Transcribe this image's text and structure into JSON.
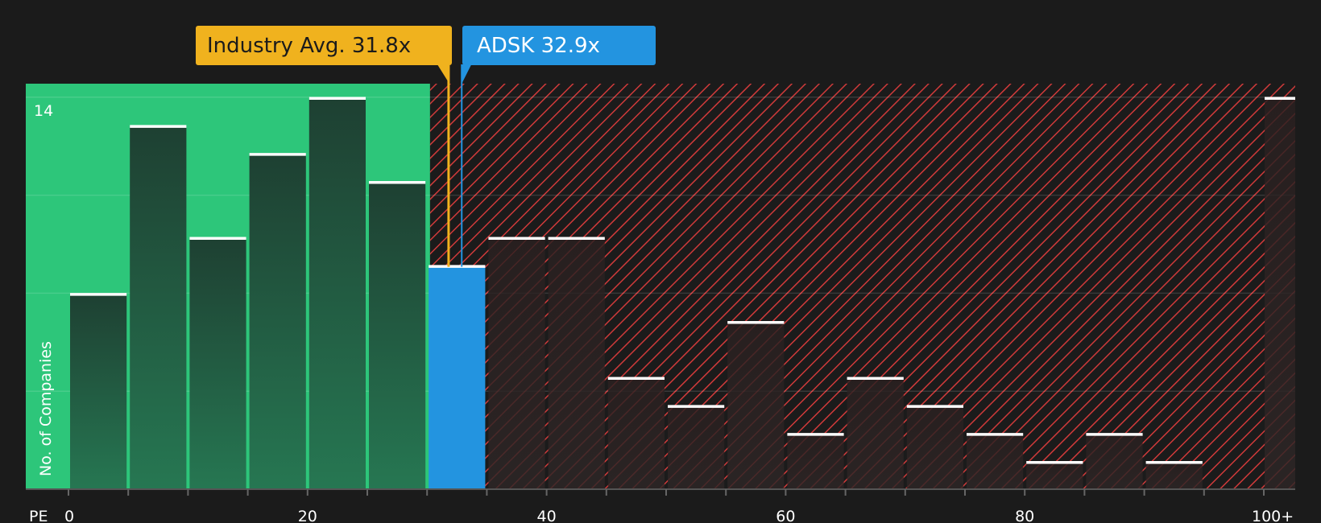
{
  "chart_data": {
    "type": "bar",
    "xlabel": "PE",
    "ylabel": "No. of Companies",
    "ylim": [
      0,
      14.5
    ],
    "y_tick_labels": [
      "14"
    ],
    "x_tick_labels": [
      "0",
      "20",
      "40",
      "60",
      "80",
      "100+"
    ],
    "bins": [
      {
        "from": 0,
        "to": 5,
        "value": 7
      },
      {
        "from": 5,
        "to": 10,
        "value": 13
      },
      {
        "from": 10,
        "to": 15,
        "value": 9
      },
      {
        "from": 15,
        "to": 20,
        "value": 12
      },
      {
        "from": 20,
        "to": 25,
        "value": 14
      },
      {
        "from": 25,
        "to": 30,
        "value": 11
      },
      {
        "from": 30,
        "to": 35,
        "value": 8,
        "highlight": true
      },
      {
        "from": 35,
        "to": 40,
        "value": 9
      },
      {
        "from": 40,
        "to": 45,
        "value": 9
      },
      {
        "from": 45,
        "to": 50,
        "value": 4
      },
      {
        "from": 50,
        "to": 55,
        "value": 3
      },
      {
        "from": 55,
        "to": 60,
        "value": 6
      },
      {
        "from": 60,
        "to": 65,
        "value": 2
      },
      {
        "from": 65,
        "to": 70,
        "value": 4
      },
      {
        "from": 70,
        "to": 75,
        "value": 3
      },
      {
        "from": 75,
        "to": 80,
        "value": 2
      },
      {
        "from": 80,
        "to": 85,
        "value": 1
      },
      {
        "from": 85,
        "to": 90,
        "value": 2
      },
      {
        "from": 90,
        "to": 95,
        "value": 1
      },
      {
        "from": 100,
        "to": 102.5,
        "value": 14
      }
    ],
    "industry_avg": {
      "label": "Industry Avg. 31.8x",
      "value": 31.8
    },
    "company": {
      "label": "ADSK 32.9x",
      "value": 32.9
    }
  },
  "colors": {
    "background": "#1b1b1b",
    "undervalued_zone": "#2dc67a",
    "overvalued_hatch": "#d03a3a",
    "bar_fill_green": "#1f3d2e",
    "bar_fill_dark": "#2b1f1f",
    "highlight_bar": "#2394e0",
    "industry_callout": "#f0b21e",
    "company_callout": "#2394e0"
  }
}
